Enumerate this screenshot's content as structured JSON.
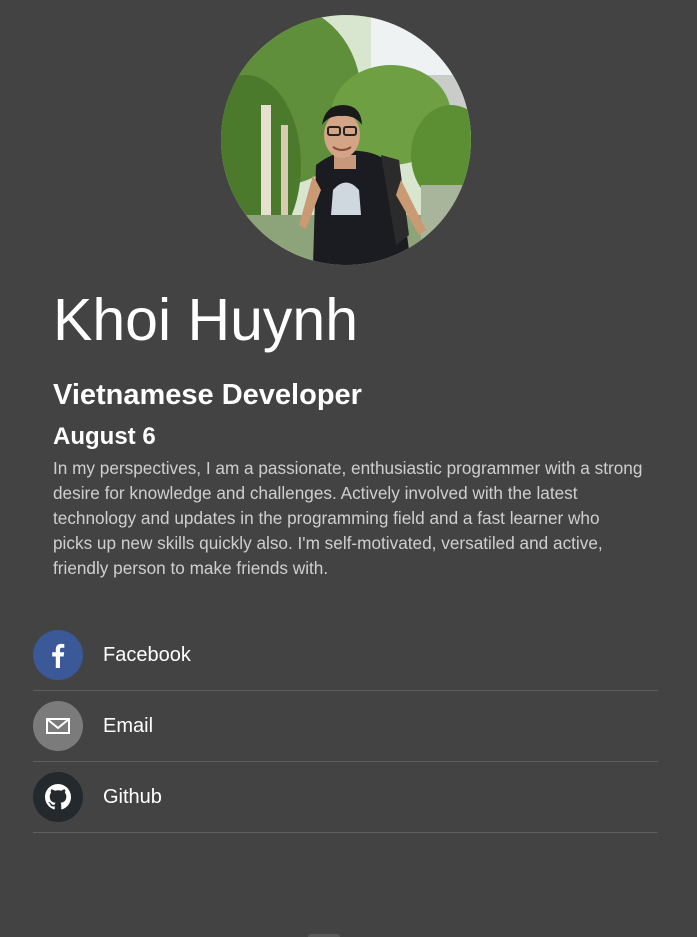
{
  "profile": {
    "name": "Khoi Huynh",
    "role": "Vietnamese Developer",
    "date": "August 6",
    "bio": "In my perspectives, I am a passionate, enthusiastic programmer with a strong desire for knowledge and challenges. Actively involved with the latest technology and updates in the programming field and a fast learner who picks up new skills quickly also. I'm self-motivated, versatiled and active, friendly person to make friends with."
  },
  "links": [
    {
      "label": "Facebook",
      "icon": "facebook-icon",
      "color": "#3b5998"
    },
    {
      "label": "Email",
      "icon": "email-icon",
      "color": "#7b7b7b"
    },
    {
      "label": "Github",
      "icon": "github-icon",
      "color": "#24292e"
    }
  ],
  "colors": {
    "background": "#434343",
    "text": "#ffffff",
    "bio_text": "#cfcfcf",
    "divider": "#5e5e5e"
  }
}
